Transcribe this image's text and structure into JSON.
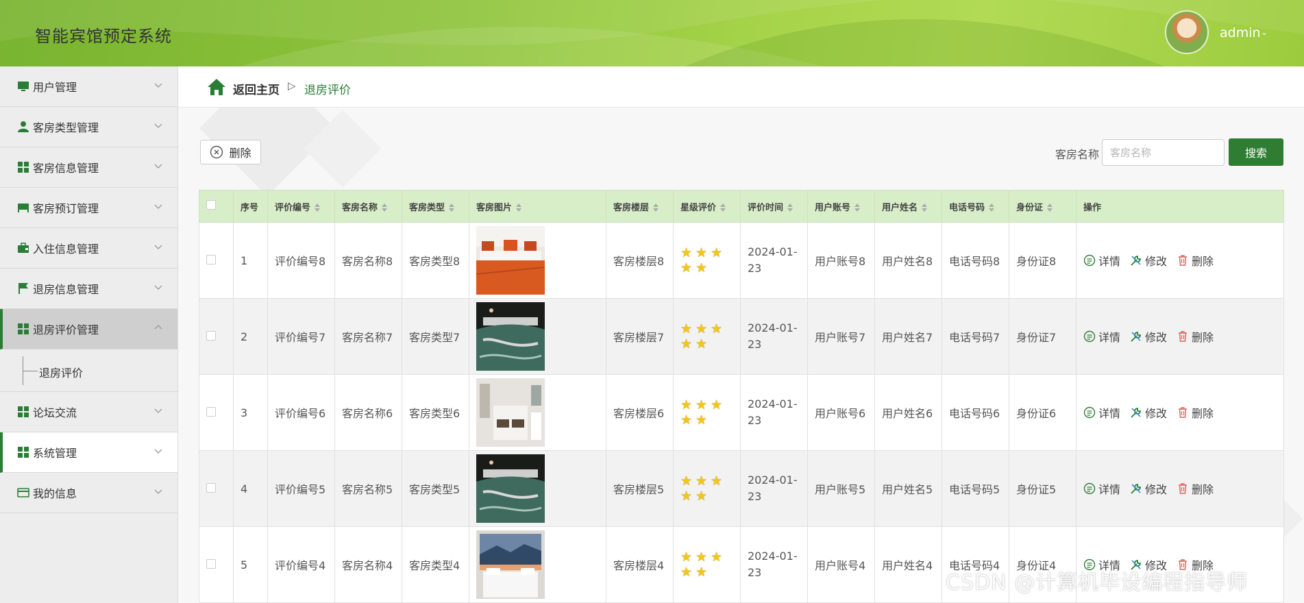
{
  "header": {
    "title": "智能宾馆预定系统",
    "user": "admin"
  },
  "sidebar": {
    "items": [
      {
        "label": "用户管理",
        "icon": "monitor-icon"
      },
      {
        "label": "客房类型管理",
        "icon": "person-icon"
      },
      {
        "label": "客房信息管理",
        "icon": "grid-icon"
      },
      {
        "label": "客房预订管理",
        "icon": "bed-icon"
      },
      {
        "label": "入住信息管理",
        "icon": "briefcase-icon"
      },
      {
        "label": "退房信息管理",
        "icon": "flag-icon"
      },
      {
        "label": "退房评价管理",
        "icon": "grid-icon"
      },
      {
        "label": "论坛交流",
        "icon": "grid-icon"
      },
      {
        "label": "系统管理",
        "icon": "grid-icon"
      },
      {
        "label": "我的信息",
        "icon": "card-icon"
      }
    ],
    "sub_item": "退房评价"
  },
  "breadcrumb": {
    "home": "返回主页",
    "sep": "▷",
    "current": "退房评价"
  },
  "toolbar": {
    "delete_label": "删除",
    "search_label": "客房名称",
    "search_placeholder": "客房名称",
    "search_button": "搜索"
  },
  "table": {
    "headers": [
      "序号",
      "评价编号",
      "客房名称",
      "客房类型",
      "客房图片",
      "客房楼层",
      "星级评价",
      "评价时间",
      "用户账号",
      "用户姓名",
      "电话号码",
      "身份证",
      "操作"
    ],
    "rows": [
      {
        "no": "1",
        "code": "评价编号8",
        "name": "客房名称8",
        "type": "客房类型8",
        "image": "orange-bed",
        "floor": "客房楼层8",
        "stars": 5,
        "date1": "2024-01-",
        "date2": "23",
        "account": "用户账号8",
        "uname": "用户姓名8",
        "phone": "电话号码8",
        "id": "身份证8"
      },
      {
        "no": "2",
        "code": "评价编号7",
        "name": "客房名称7",
        "type": "客房类型7",
        "image": "green-bed",
        "floor": "客房楼层7",
        "stars": 5,
        "date1": "2024-01-",
        "date2": "23",
        "account": "用户账号7",
        "uname": "用户姓名7",
        "phone": "电话号码7",
        "id": "身份证7"
      },
      {
        "no": "3",
        "code": "评价编号6",
        "name": "客房名称6",
        "type": "客房类型6",
        "image": "room-overview",
        "floor": "客房楼层6",
        "stars": 5,
        "date1": "2024-01-",
        "date2": "23",
        "account": "用户账号6",
        "uname": "用户姓名6",
        "phone": "电话号码6",
        "id": "身份证6"
      },
      {
        "no": "4",
        "code": "评价编号5",
        "name": "客房名称5",
        "type": "客房类型5",
        "image": "green-bed",
        "floor": "客房楼层5",
        "stars": 5,
        "date1": "2024-01-",
        "date2": "23",
        "account": "用户账号5",
        "uname": "用户姓名5",
        "phone": "电话号码5",
        "id": "身份证5"
      },
      {
        "no": "5",
        "code": "评价编号4",
        "name": "客房名称4",
        "type": "客房类型4",
        "image": "white-bed-mural",
        "floor": "客房楼层4",
        "stars": 5,
        "date1": "2024-01-",
        "date2": "23",
        "account": "用户账号4",
        "uname": "用户姓名4",
        "phone": "电话号码4",
        "id": "身份证4"
      }
    ],
    "actions": {
      "detail": "详情",
      "edit": "修改",
      "delete": "删除"
    }
  },
  "watermark": "CSDN @计算机毕设编程指导师",
  "colors": {
    "primary": "#2e7d32",
    "header_green": "#8fc43c",
    "table_header": "#d8eec8",
    "star": "#f5c518"
  }
}
